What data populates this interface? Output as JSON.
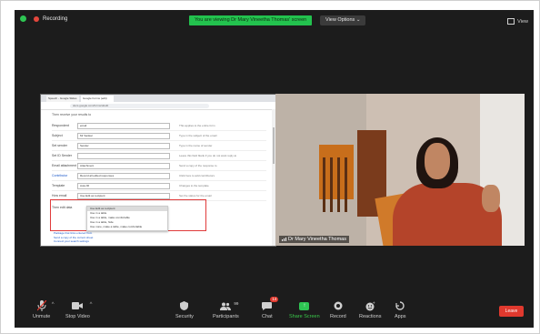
{
  "topbar": {
    "recording": "Recording",
    "viewing_banner": "You are viewing Dr Mary Vineetha Thomas' screen",
    "view_options": "View Options ⌄",
    "view": "View"
  },
  "shared_screen": {
    "tabs": [
      "Speech - Google Slides",
      "Google Forms (edit)"
    ],
    "address": "docs.google.com/forms/d/edit",
    "header": "Then receive your results to",
    "fields": [
      {
        "label": "Respondent",
        "value": "email",
        "desc": "This applies to the entire form"
      },
      {
        "label": "Subject",
        "value": "Mr Sankar",
        "desc": "Type in the subject of the email"
      },
      {
        "label": "Set sender",
        "value": "Sender",
        "desc": "Type in the name of sender"
      },
      {
        "label": "Set ID Sender",
        "value": "",
        "desc": "Leave this field blank if you do not want reply-to"
      },
      {
        "label": "Email attachment",
        "value": "Attachment",
        "desc": "Send a copy of the response to"
      },
      {
        "label": "Contributor",
        "value": "Record all edited responses",
        "desc": "Click here to add contributors",
        "blue": true
      },
      {
        "label": "Template",
        "value": "Auto-fill",
        "desc": "Changes to the template"
      },
      {
        "label": "How email",
        "value": "Use Edit as recipient",
        "desc": "Set the status for the email"
      }
    ],
    "dropdown": [
      "Use Edit as recipient",
      "Use in a table",
      "Use in a table, make comfortable",
      "Use in a table, hide",
      "Use none, make a table, make comfortable"
    ],
    "below_label": "Then edit data",
    "links": [
      "Package that links entered from",
      "Send a copy of the current sheet",
      "Connect your search settings"
    ]
  },
  "video": {
    "name": "Dr Mary Vineetha Thomas"
  },
  "toolbar": {
    "unmute": "Unmute",
    "stop_video": "Stop Video",
    "security": "Security",
    "participants": "Participants",
    "participants_count": "99",
    "chat": "Chat",
    "chat_badge": "14",
    "share_screen": "Share Screen",
    "record": "Record",
    "reactions": "Reactions",
    "apps": "Apps",
    "leave": "Leave"
  },
  "colors": {
    "accent_green": "#2ec553",
    "leave_red": "#e0392e",
    "background": "#1c1c1c"
  }
}
